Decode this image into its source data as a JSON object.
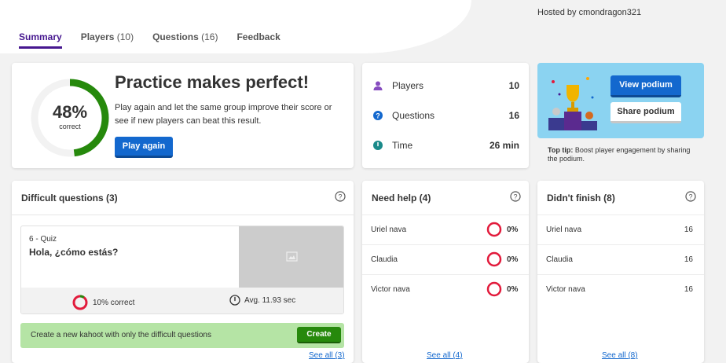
{
  "header": {
    "hosted_by": "Hosted by cmondragon321",
    "tabs": [
      {
        "label": "Summary",
        "count": ""
      },
      {
        "label": "Players",
        "count": "(10)"
      },
      {
        "label": "Questions",
        "count": "(16)"
      },
      {
        "label": "Feedback",
        "count": ""
      }
    ],
    "active_tab": "Summary"
  },
  "summary": {
    "percent": "48%",
    "percent_value": 0.48,
    "percent_label": "correct",
    "headline": "Practice makes perfect!",
    "description": "Play again and let the same group improve their score or see if new players can beat this result.",
    "play_again_label": "Play again"
  },
  "stats": {
    "players_label": "Players",
    "players_value": "10",
    "questions_label": "Questions",
    "questions_value": "16",
    "time_label": "Time",
    "time_value": "26 min"
  },
  "podium": {
    "view_label": "View podium",
    "share_label": "Share podium",
    "tip_bold": "Top tip:",
    "tip_text": " Boost player engagement by sharing the podium."
  },
  "difficult": {
    "title": "Difficult questions (3)",
    "question_type": "6 - Quiz",
    "question_title": "Hola, ¿cómo estás?",
    "correct_text": "10% correct",
    "correct_value": 0.1,
    "avg_text": "Avg. 11.93 sec",
    "create_text": "Create a new kahoot with only the difficult questions",
    "create_label": "Create",
    "see_all": "See all (3)"
  },
  "need_help": {
    "title": "Need help (4)",
    "rows": [
      {
        "name": "Uriel nava",
        "pct": "0%"
      },
      {
        "name": "Claudia",
        "pct": "0%"
      },
      {
        "name": "Victor nava",
        "pct": "0%"
      }
    ],
    "see_all": "See all (4)"
  },
  "didnt_finish": {
    "title": "Didn't finish (8)",
    "rows": [
      {
        "name": "Uriel nava",
        "value": "16"
      },
      {
        "name": "Claudia",
        "value": "16"
      },
      {
        "name": "Victor nava",
        "value": "16"
      }
    ],
    "see_all": "See all (8)"
  },
  "colors": {
    "accent_purple": "#46178f",
    "blue": "#1368ce",
    "green": "#26890c",
    "red": "#e21b3c",
    "podium_bg": "#8bd3f1"
  }
}
